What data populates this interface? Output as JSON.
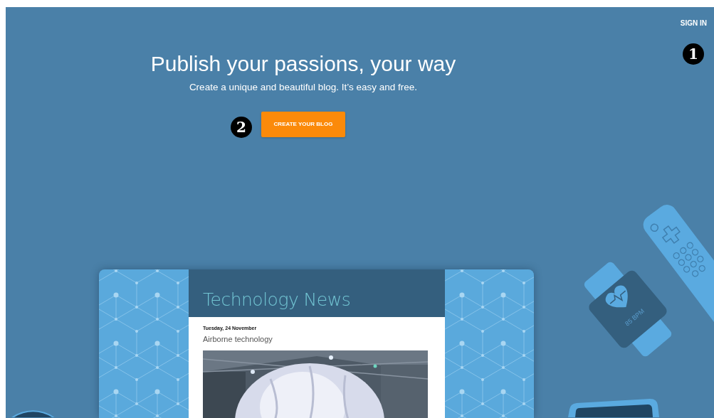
{
  "header": {
    "sign_in": "SIGN IN",
    "marker": "1"
  },
  "hero": {
    "title": "Publish your passions, your way",
    "subtitle": "Create a unique and beautiful blog. It’s easy and free.",
    "cta": "CREATE YOUR BLOG",
    "marker": "2"
  },
  "preview": {
    "blog_title": "Technology News",
    "post_date": "Tuesday, 24 November",
    "post_title": "Airborne technology"
  },
  "illustration": {
    "watch_reading": "85 BPM"
  }
}
